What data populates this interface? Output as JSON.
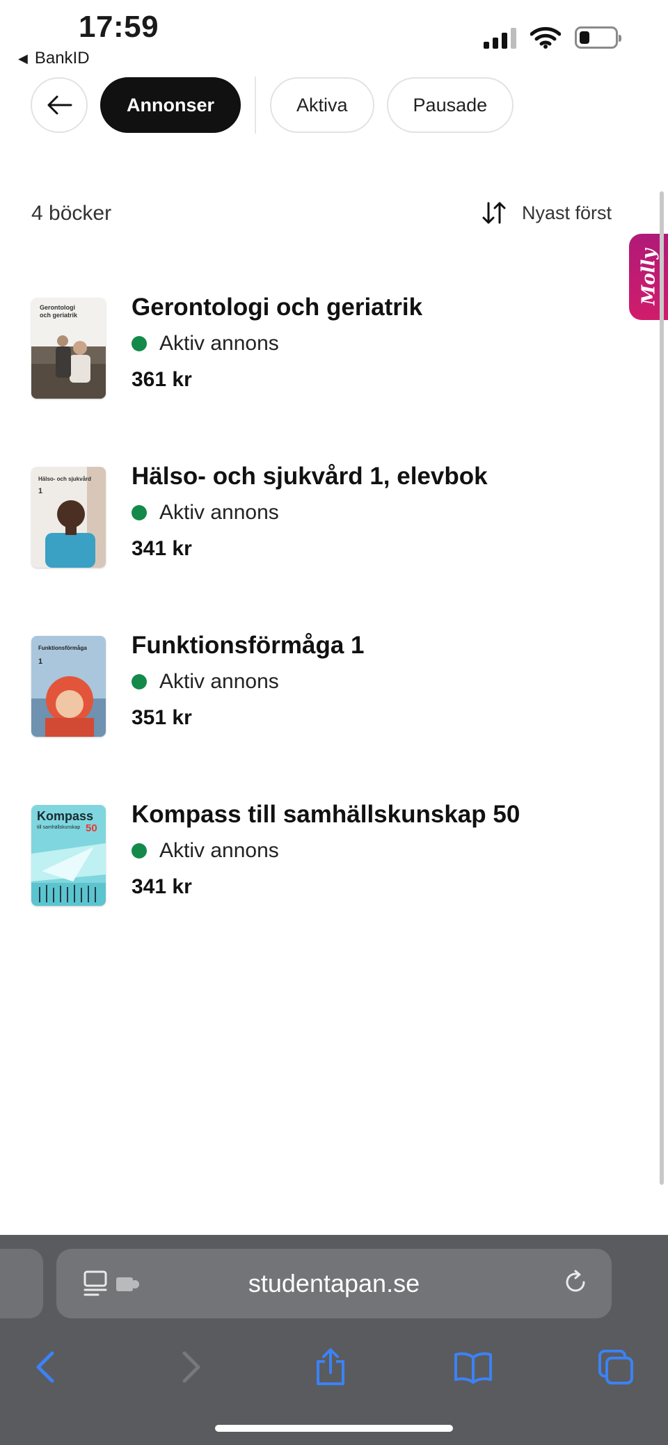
{
  "status_bar": {
    "time": "17:59",
    "back_app": "BankID"
  },
  "filters": {
    "items": [
      {
        "label": "Annonser",
        "active": true
      },
      {
        "label": "Aktiva",
        "active": false
      },
      {
        "label": "Pausade",
        "active": false
      }
    ]
  },
  "list_header": {
    "count": "4 böcker",
    "sort_label": "Nyast först"
  },
  "molly_tab": {
    "label": "Molly"
  },
  "books": [
    {
      "title": "Gerontologi och geriatrik",
      "status": "Aktiv annons",
      "price": "361 kr",
      "cover_title": "Gerontologi och geriatrik"
    },
    {
      "title": "Hälso- och sjukvård 1, elevbok",
      "status": "Aktiv annons",
      "price": "341 kr",
      "cover_title": "Hälso- och sjukvård",
      "cover_number": "1"
    },
    {
      "title": "Funktionsförmåga 1",
      "status": "Aktiv annons",
      "price": "351 kr",
      "cover_title": "Funktionsförmåga",
      "cover_number": "1"
    },
    {
      "title": "Kompass till samhällskunskap 50",
      "status": "Aktiv annons",
      "price": "341 kr",
      "cover_title": "Kompass",
      "cover_subtitle": "till samhällskunskap",
      "cover_number": "50"
    }
  ],
  "browser": {
    "url": "studentapan.se"
  },
  "colors": {
    "active_status": "#138a4a",
    "molly": "#c21b72",
    "safari_accent": "#3b82f6"
  }
}
